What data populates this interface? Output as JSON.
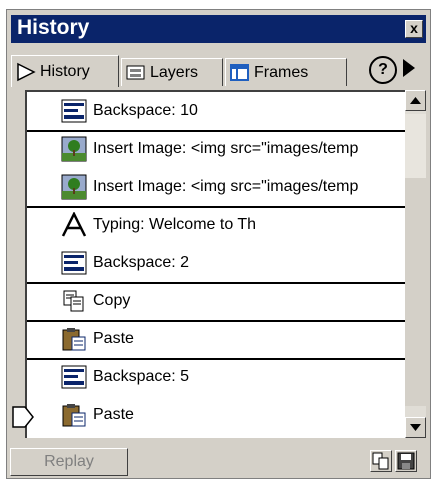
{
  "panel": {
    "title": "History",
    "close_label": "x",
    "help_label": "?"
  },
  "tabs": [
    {
      "label": "History",
      "icon": "play-triangle-icon",
      "active": true
    },
    {
      "label": "Layers",
      "icon": "layers-icon",
      "active": false
    },
    {
      "label": "Frames",
      "icon": "frames-icon",
      "active": false
    }
  ],
  "history_items": [
    {
      "label": "Backspace: 10",
      "icon": "backspace-icon"
    },
    {
      "label": "Insert Image: <img src=\"images/temp",
      "icon": "insert-image-icon"
    },
    {
      "label": "Insert Image: <img src=\"images/temp",
      "icon": "insert-image-icon"
    },
    {
      "label": "Typing: Welcome to Th",
      "icon": "typing-icon"
    },
    {
      "label": "Backspace: 2",
      "icon": "backspace-icon"
    },
    {
      "label": "Copy",
      "icon": "copy-icon"
    },
    {
      "label": "Paste",
      "icon": "paste-icon"
    },
    {
      "label": "Backspace: 5",
      "icon": "backspace-icon"
    },
    {
      "label": "Paste",
      "icon": "paste-icon"
    }
  ],
  "footer": {
    "replay_label": "Replay"
  },
  "colors": {
    "titlebar": "#0a246a",
    "panel_bg": "#d4d0c8",
    "selection": "#ffffff"
  }
}
